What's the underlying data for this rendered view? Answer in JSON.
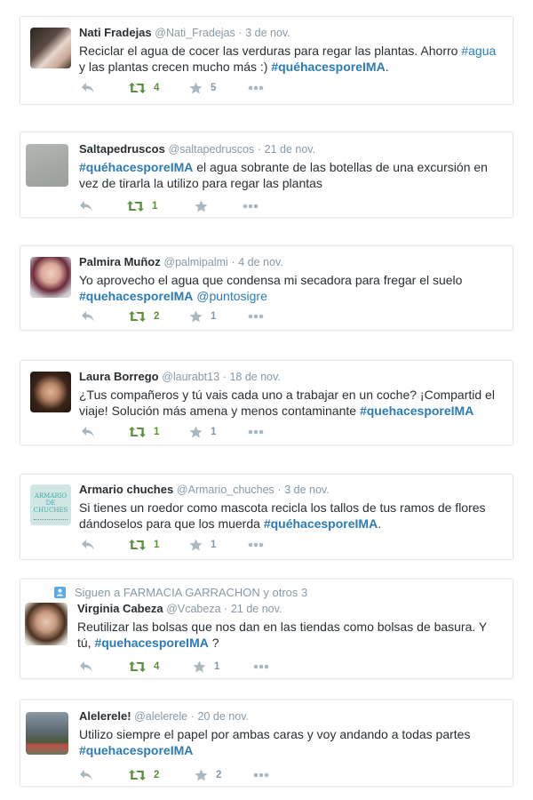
{
  "tweets": [
    {
      "fullname": "Nati Fradejas",
      "handle": "@Nati_Fradejas",
      "date": "3 de nov.",
      "text_parts": [
        "Reciclar el agua de cocer las verduras para regar las plantas. Ahorro ",
        "#agua",
        " y las plantas crecen mucho más :) ",
        "#quéhacesporeIMA",
        "."
      ],
      "retweets": "4",
      "favorites": "5"
    },
    {
      "fullname": "Saltapedruscos",
      "handle": "@saltapedruscos",
      "date": "21 de nov.",
      "text_parts": [
        "#quéhacesporeIMA",
        " el agua sobrante de las botellas de una excursión en vez de tirarla la utilizo para regar las plantas"
      ],
      "retweets": "1",
      "favorites": ""
    },
    {
      "fullname": "Palmira Muñoz",
      "handle": "@palmipalmi",
      "date": "4 de nov.",
      "text_parts": [
        "Yo aprovecho el agua que condensa mi secadora para fregar el suelo ",
        "#quehacesporeIMA",
        " ",
        "@puntosigre"
      ],
      "retweets": "2",
      "favorites": "1"
    },
    {
      "fullname": "Laura Borrego",
      "handle": "@laurabt13",
      "date": "18 de nov.",
      "text_parts": [
        "¿Tus compañeros y tú vais cada uno a trabajar en un coche? ¡Compartid el viaje! Solución más amena y menos contaminante ",
        "#quehacesporeIMA"
      ],
      "retweets": "1",
      "favorites": "1"
    },
    {
      "fullname": "Armario chuches",
      "handle": "@Armario_chuches",
      "date": "3 de nov.",
      "avatar_text": [
        "ARMARIO DE",
        "CHUCHES"
      ],
      "text_parts": [
        "Si tienes un roedor como mascota recicla los tallos de tus ramos de flores dándoselos para que los muerda ",
        "#quéhacesporeIMA",
        "."
      ],
      "retweets": "1",
      "favorites": "1"
    },
    {
      "context": "Siguen a FARMACIA GARRACHON y otros 3",
      "fullname": "Virginia Cabeza",
      "handle": "@Vcabeza",
      "date": "21 de nov.",
      "text_parts": [
        "Reutilizar las bolsas que nos dan en las tiendas como bolsas de basura. Y tú, ",
        "#quehacesporeIMA",
        " ?"
      ],
      "retweets": "4",
      "favorites": "1"
    },
    {
      "fullname": "Alelerele!",
      "handle": "@alelerele",
      "date": "20 de nov.",
      "text_parts": [
        "Utilizo siempre el papel por ambas caras y voy andando a todas partes ",
        "#quehacesporeIMA"
      ],
      "retweets": "2",
      "favorites": "2"
    }
  ],
  "colors": {
    "link": "#2b7bb9",
    "retweet_green": "#5c913b",
    "meta_gray": "#8899a6",
    "icon_gray": "#aab8c2"
  },
  "icons": [
    "reply-icon",
    "retweet-icon",
    "favorite-star-icon",
    "more-icon",
    "follow-context-icon"
  ]
}
